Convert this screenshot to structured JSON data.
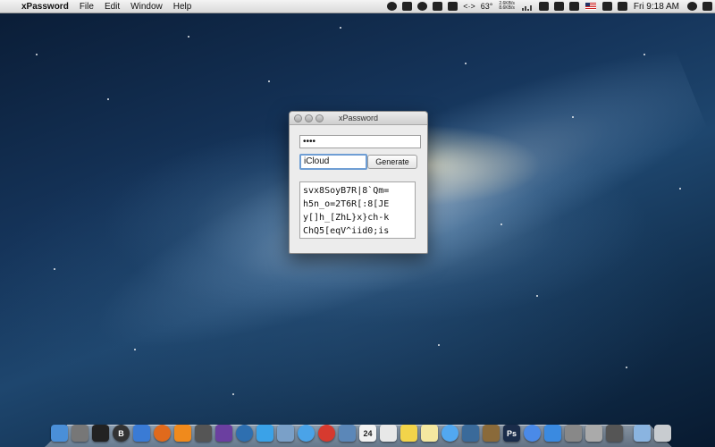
{
  "menubar": {
    "app_name": "xPassword",
    "menus": [
      "File",
      "Edit",
      "Window",
      "Help"
    ],
    "temperature": "63°",
    "net_up": "2.6KB/s",
    "net_down": "8.6KB/s",
    "clock": "Fri 9:18 AM"
  },
  "window": {
    "title": "xPassword",
    "master_password": "••••",
    "site_value": "iCloud",
    "generate_label": "Generate",
    "output_lines": [
      "svx8SoyB7R|8`Qm=",
      "h5n_o=2T6R[:8[JE",
      "y[]h_[ZhL}x}ch-k",
      "ChQ5[eqV^iid0;is"
    ]
  },
  "dock": {
    "calendar_day": "24",
    "items": [
      {
        "icon": "finder-icon",
        "color": "#4a8fd8"
      },
      {
        "icon": "launchpad-icon",
        "color": "#777"
      },
      {
        "icon": "terminal-icon",
        "color": "#222"
      },
      {
        "icon": "bbedit-icon",
        "color": "#333",
        "glyph": "B"
      },
      {
        "icon": "pencil-app-icon",
        "color": "#3a7bd5"
      },
      {
        "icon": "firefox-icon",
        "color": "#e06a1c"
      },
      {
        "icon": "xampp-icon",
        "color": "#f08a1c"
      },
      {
        "icon": "calculator-icon",
        "color": "#555"
      },
      {
        "icon": "omnifocus-icon",
        "color": "#6b3fa0"
      },
      {
        "icon": "globe-app-icon",
        "color": "#2e6fb0"
      },
      {
        "icon": "twitter-icon",
        "color": "#3aa2e8"
      },
      {
        "icon": "preview-icon",
        "color": "#7aa0c8"
      },
      {
        "icon": "safari-icon",
        "color": "#4aa3e8"
      },
      {
        "icon": "chrome-icon",
        "color": "#d63a2f"
      },
      {
        "icon": "mail-icon",
        "color": "#5b87b8"
      },
      {
        "icon": "calendar-icon",
        "color": "#f2f2f2"
      },
      {
        "icon": "textedit-icon",
        "color": "#e8e8e8"
      },
      {
        "icon": "stickies-icon",
        "color": "#f2d44a"
      },
      {
        "icon": "notes-icon",
        "color": "#f4e8a0"
      },
      {
        "icon": "messages-icon",
        "color": "#52a8f0"
      },
      {
        "icon": "facetime-icon",
        "color": "#3a6a9a"
      },
      {
        "icon": "photo-app-icon",
        "color": "#8a6a3a"
      },
      {
        "icon": "photoshop-icon",
        "color": "#1a2c4a",
        "glyph": "Ps"
      },
      {
        "icon": "itunes-icon",
        "color": "#4a8ae8"
      },
      {
        "icon": "appstore-icon",
        "color": "#3a8ae0"
      },
      {
        "icon": "system-preferences-icon",
        "color": "#888"
      },
      {
        "icon": "utility-icon",
        "color": "#aaa"
      },
      {
        "icon": "lock-icon",
        "color": "#555"
      },
      {
        "icon": "folder-icon",
        "color": "#8ab4e0"
      },
      {
        "icon": "trash-icon",
        "color": "#c8ccd0"
      }
    ]
  }
}
